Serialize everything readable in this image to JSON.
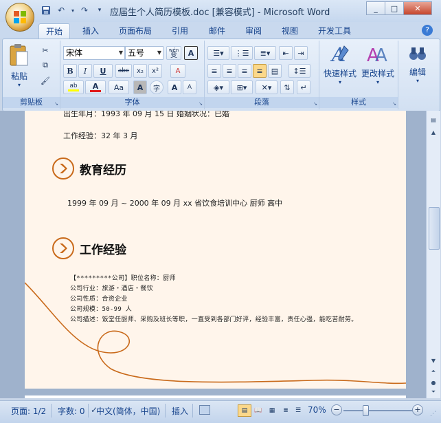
{
  "window": {
    "title": "应届生个人简历模板.doc [兼容模式] - Microsoft Word",
    "minimize": "_",
    "maximize": "□",
    "close": "✕"
  },
  "qat": {
    "save": "💾",
    "undo": "↶",
    "redo": "↷",
    "more": "▾"
  },
  "tabs": [
    "开始",
    "插入",
    "页面布局",
    "引用",
    "邮件",
    "审阅",
    "视图",
    "开发工具"
  ],
  "ribbon": {
    "clipboard": {
      "paste_label": "粘贴",
      "group_label": "剪贴板"
    },
    "font": {
      "font_name": "宋体",
      "font_size": "五号",
      "wen_label": "wén",
      "wen_char": "变",
      "frame_a": "A",
      "bold": "B",
      "italic": "I",
      "underline": "U",
      "strike": "abc",
      "subscript": "x₂",
      "superscript": "x²",
      "clear_format": "A",
      "highlight": "ab",
      "font_color": "A",
      "case": "Aa",
      "shading_a": "A",
      "circle_char": "字",
      "grow": "A",
      "shrink": "A",
      "group_label": "字体"
    },
    "paragraph": {
      "group_label": "段落"
    },
    "styles": {
      "quick_label": "快速样式",
      "change_label": "更改样式",
      "group_label": "样式"
    },
    "editing": {
      "label": "编辑"
    }
  },
  "document": {
    "top_partial": "出生年月：1993 年 09 月 15 日              婚姻状况：已婚",
    "work_experience_years": "工作经验：32 年  3 月",
    "education_heading": "教育经历",
    "education_line": "1999 年 09 月 ~ 2000 年 09 月   xx 省饮食培训中心  厨师  高中",
    "work_heading": "工作经验",
    "work_lines": [
      "【*********公司】职位名称：厨师",
      "公司行业：旅游・酒店・餐饮",
      "公司性质：合资企业",
      "公司规模：50-99 人",
      "公司描述：饭堂任厨师、采购及班长等职，一直受到各部门好评，经验丰富，责任心强，能吃苦耐劳。"
    ]
  },
  "status": {
    "page": "页面: 1/2",
    "words": "字数: 0",
    "language": "中文(简体，中国)",
    "insert_mode": "插入",
    "zoom": "70%"
  },
  "colors": {
    "accent_orange": "#c96a1b",
    "page_bg": "#fff5eb"
  }
}
